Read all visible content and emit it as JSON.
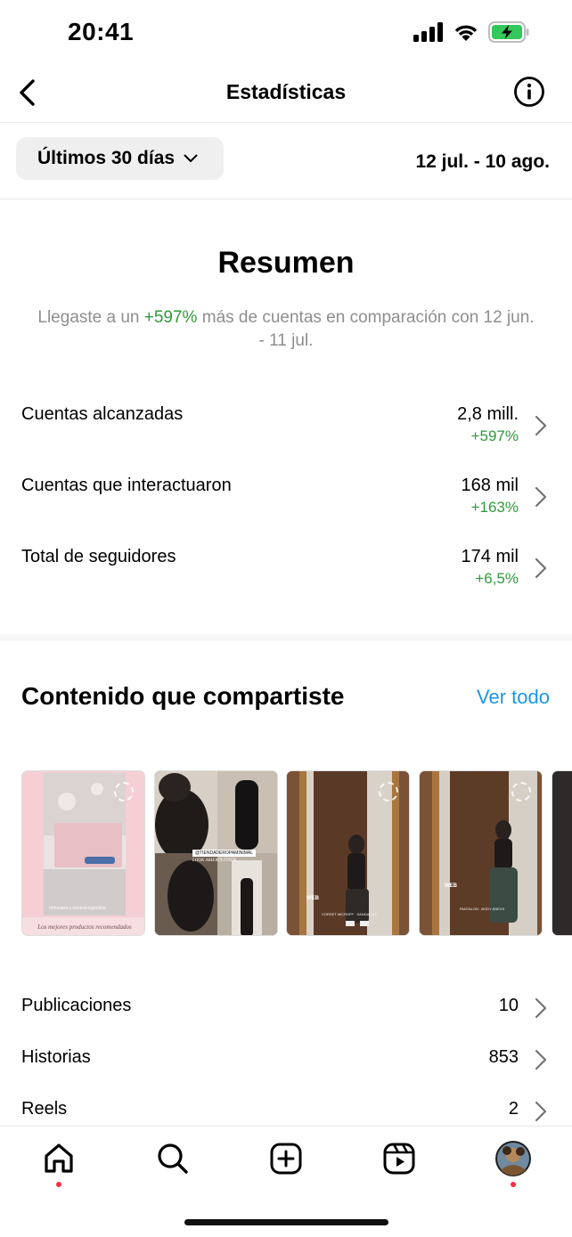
{
  "status_bar": {
    "time": "20:41"
  },
  "nav": {
    "title": "Estadísticas"
  },
  "filter": {
    "range_label": "Últimos 30 días",
    "dates": "12 jul. - 10 ago."
  },
  "summary": {
    "title": "Resumen",
    "desc_prefix": "Llegaste a un ",
    "desc_highlight": "+597%",
    "desc_suffix": " más de cuentas en comparación con 12 jun. - 11 jul."
  },
  "metrics": [
    {
      "label": "Cuentas alcanzadas",
      "value": "2,8 mill.",
      "change": "+597%"
    },
    {
      "label": "Cuentas que interactuaron",
      "value": "168 mil",
      "change": "+163%"
    },
    {
      "label": "Total de seguidores",
      "value": "174 mil",
      "change": "+6,5%"
    }
  ],
  "content": {
    "title": "Contenido que compartiste",
    "see_all": "Ver todo",
    "thumbs": [
      {
        "caption": "Los mejores productos recomendados",
        "overlay": "rsmuraira y nunicarargentina"
      },
      {
        "overlay": "@TIENDADEROPAMINIMAL",
        "caption": "LOOK ABIERTA FINDE"
      },
      {
        "overlay": "WEB",
        "caption": "CORSET MICROFF · SANDALIAS"
      },
      {
        "overlay": "WEB",
        "caption": "PANTALON · BODY ANEXS"
      },
      {
        "overlay": ""
      }
    ]
  },
  "list": [
    {
      "label": "Publicaciones",
      "value": "10"
    },
    {
      "label": "Historias",
      "value": "853"
    },
    {
      "label": "Reels",
      "value": "2"
    }
  ],
  "tabs": [
    "home-tab",
    "search-tab",
    "create-tab",
    "reels-tab",
    "profile-tab"
  ],
  "colors": {
    "positive": "#2e9a3a",
    "link": "#1c96e8",
    "notification_dot": "#ff2f40",
    "battery": "#34c759"
  }
}
